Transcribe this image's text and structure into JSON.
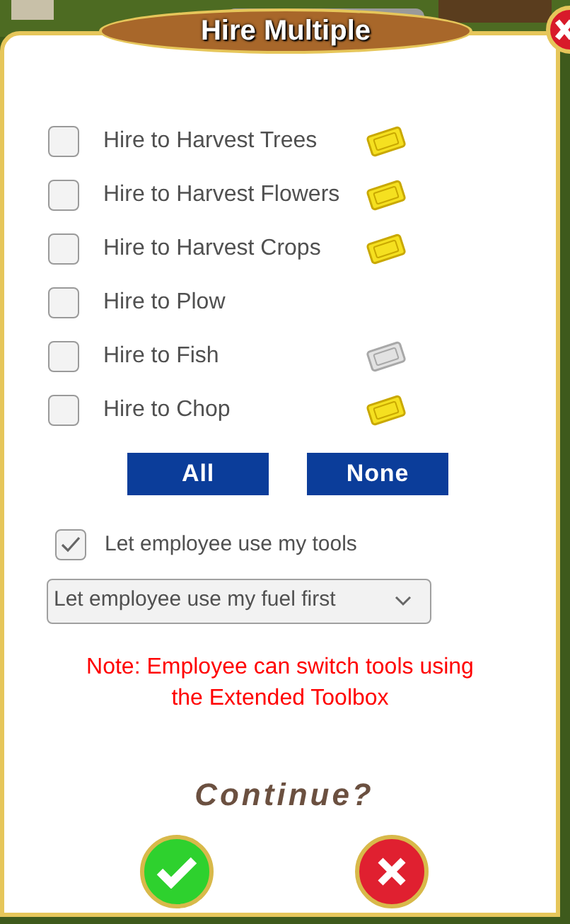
{
  "dialog": {
    "title": "Hire Multiple"
  },
  "jobs": [
    {
      "label": "Hire to Harvest Trees",
      "checked": false,
      "ticket": {
        "enabled": true
      }
    },
    {
      "label": "Hire to Harvest Flowers",
      "checked": false,
      "ticket": {
        "enabled": true
      }
    },
    {
      "label": "Hire to Harvest Crops",
      "checked": false,
      "ticket": {
        "enabled": true
      }
    },
    {
      "label": "Hire to Plow",
      "checked": false
    },
    {
      "label": "Hire to Fish",
      "checked": false,
      "ticket": {
        "enabled": false
      }
    },
    {
      "label": "Hire to Chop",
      "checked": false,
      "ticket": {
        "enabled": true
      }
    }
  ],
  "select_buttons": [
    "All",
    "None"
  ],
  "tools_option": {
    "label": "Let employee use my tools",
    "checked": true
  },
  "fuel_dropdown": {
    "value": "Let employee use my fuel first"
  },
  "note": "Note: Employee can switch tools using the Extended Toolbox",
  "prompt": "Continue?"
}
